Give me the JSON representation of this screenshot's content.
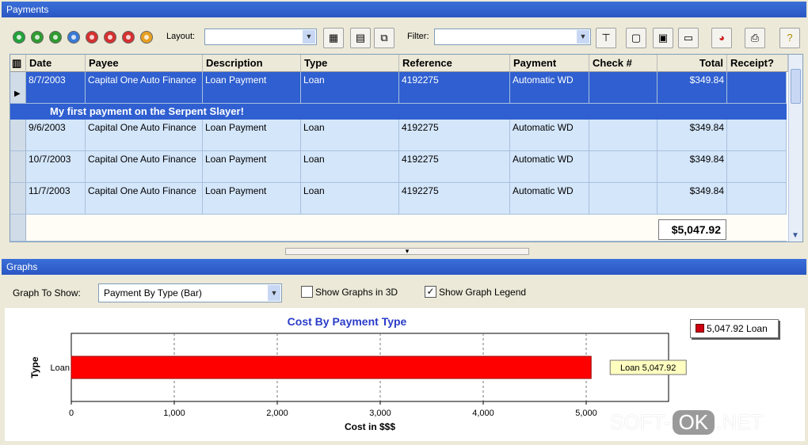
{
  "payments_panel": {
    "title": "Payments"
  },
  "toolbar": {
    "circle_colors": [
      "#22a33a",
      "#2f9b2f",
      "#2f9b2f",
      "#3a7ad6",
      "#d63030",
      "#d63030",
      "#d63030",
      "#e8a020"
    ],
    "layout_label": "Layout:",
    "layout_value": "",
    "filter_label": "Filter:",
    "filter_value": "",
    "buttons": [
      "excel-icon",
      "report-icon",
      "copy-icon",
      "filter-icon",
      "columns-icon",
      "group-icon",
      "print-preview-icon",
      "pie-icon",
      "print-icon",
      "help-icon"
    ]
  },
  "grid": {
    "columns": [
      "Date",
      "Payee",
      "Description",
      "Type",
      "Reference",
      "Payment",
      "Check #",
      "Total",
      "Receipt?"
    ],
    "rows": [
      {
        "date": "8/7/2003",
        "payee": "Capital One Auto Finance",
        "description": "Loan Payment",
        "type": "Loan",
        "reference": "4192275",
        "payment": "Automatic WD",
        "check": "",
        "total": "$349.84",
        "receipt": ""
      },
      {
        "date": "9/6/2003",
        "payee": "Capital One Auto Finance",
        "description": "Loan Payment",
        "type": "Loan",
        "reference": "4192275",
        "payment": "Automatic WD",
        "check": "",
        "total": "$349.84",
        "receipt": ""
      },
      {
        "date": "10/7/2003",
        "payee": "Capital One Auto Finance",
        "description": "Loan Payment",
        "type": "Loan",
        "reference": "4192275",
        "payment": "Automatic WD",
        "check": "",
        "total": "$349.84",
        "receipt": ""
      },
      {
        "date": "11/7/2003",
        "payee": "Capital One Auto Finance",
        "description": "Loan Payment",
        "type": "Loan",
        "reference": "4192275",
        "payment": "Automatic WD",
        "check": "",
        "total": "$349.84",
        "receipt": ""
      }
    ],
    "memo": "My first payment on the Serpent Slayer!",
    "grand_total": "$5,047.92"
  },
  "graphs_panel": {
    "title": "Graphs",
    "graph_to_show_label": "Graph To Show:",
    "graph_to_show_value": "Payment By Type (Bar)",
    "show_3d_label": "Show Graphs in 3D",
    "show_3d_checked": false,
    "show_legend_label": "Show Graph Legend",
    "show_legend_checked": true
  },
  "chart_data": {
    "type": "bar",
    "orientation": "horizontal",
    "title": "Cost By Payment Type",
    "xlabel": "Cost in $$$",
    "ylabel": "Type",
    "categories": [
      "Loan"
    ],
    "series": [
      {
        "name": "Loan",
        "values": [
          5047.92
        ]
      }
    ],
    "xlim": [
      0,
      5800
    ],
    "xticks": [
      "0",
      "1,000",
      "2,000",
      "3,000",
      "4,000",
      "5,000"
    ],
    "xtick_values": [
      0,
      1000,
      2000,
      3000,
      4000,
      5000
    ],
    "bar_color": "#ff0000",
    "title_color": "#2a3cc8",
    "data_label": "Loan 5,047.92",
    "legend_entry": "5,047.92 Loan",
    "legend_position": "top-right",
    "grid": true
  },
  "watermark": {
    "left": "SOFT-",
    "ok": "OK",
    "right": ".NET"
  }
}
